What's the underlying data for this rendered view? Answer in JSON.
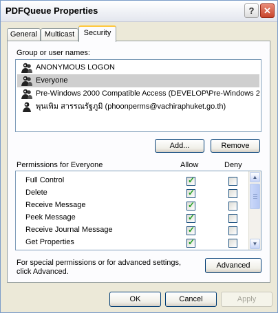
{
  "window": {
    "title": "PDFQueue Properties"
  },
  "title_buttons": {
    "help": "?",
    "close": "✕"
  },
  "tabs": [
    {
      "label": "General"
    },
    {
      "label": "Multicast"
    },
    {
      "label": "Security"
    }
  ],
  "group_section": {
    "label": "Group or user names:",
    "items": [
      {
        "name": "ANONYMOUS LOGON",
        "icon": "user-group-icon",
        "selected": false
      },
      {
        "name": "Everyone",
        "icon": "user-group-icon",
        "selected": true
      },
      {
        "name": "Pre-Windows 2000 Compatible Access (DEVELOP\\Pre-Windows 2...",
        "icon": "user-group-icon",
        "selected": false
      },
      {
        "name": "พุนเพิม สารรณรัฐภูมิ (phoonperms@vachiraphuket.go.th)",
        "icon": "user-icon",
        "selected": false
      }
    ],
    "add_label": "Add...",
    "remove_label": "Remove"
  },
  "permissions": {
    "header": "Permissions for Everyone",
    "allow_header": "Allow",
    "deny_header": "Deny",
    "rows": [
      {
        "name": "Full Control",
        "allow": true,
        "deny": false
      },
      {
        "name": "Delete",
        "allow": true,
        "deny": false
      },
      {
        "name": "Receive Message",
        "allow": true,
        "deny": false
      },
      {
        "name": "Peek Message",
        "allow": true,
        "deny": false
      },
      {
        "name": "Receive Journal Message",
        "allow": true,
        "deny": false
      },
      {
        "name": "Get Properties",
        "allow": true,
        "deny": false
      }
    ]
  },
  "advanced": {
    "text_line1": "For special permissions or for advanced settings,",
    "text_line2": "click Advanced.",
    "button_label": "Advanced"
  },
  "footer": {
    "ok_label": "OK",
    "cancel_label": "Cancel",
    "apply_label": "Apply"
  },
  "colors": {
    "selection": "#cfcfcf",
    "tab_highlight": "#ffc83c",
    "check": "#21a121"
  }
}
